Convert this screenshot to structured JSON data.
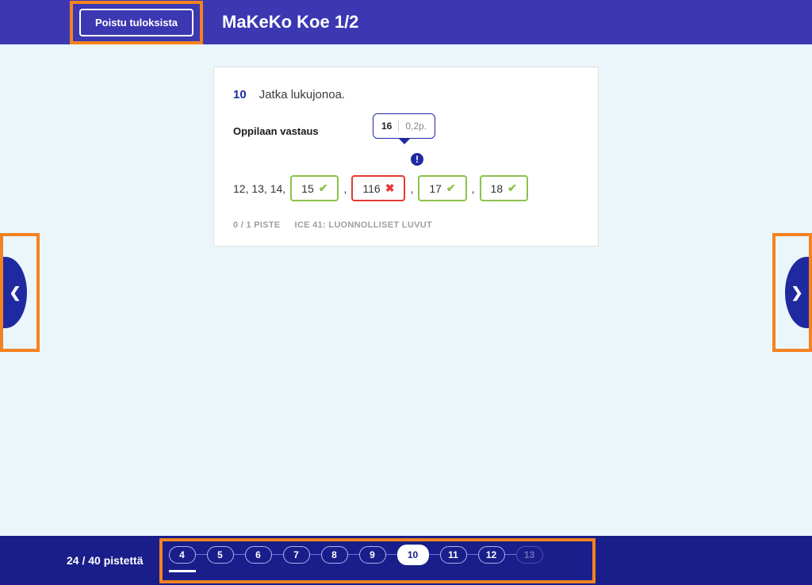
{
  "header": {
    "exit_label": "Poistu tuloksista",
    "title": "MaKeKo Koe 1/2"
  },
  "question": {
    "number": "10",
    "prompt": "Jatka lukujonoa.",
    "answer_label": "Oppilaan vastaus",
    "tooltip_value": "16",
    "tooltip_points": "0,2p.",
    "prefix": "12, 13, 14,",
    "sep": ",",
    "items": [
      {
        "value": "15",
        "correct": true
      },
      {
        "value": "116",
        "correct": false
      },
      {
        "value": "17",
        "correct": true
      },
      {
        "value": "18",
        "correct": true
      }
    ],
    "score_meta": "0 / 1 PISTE",
    "topic_meta": "ICE 41: LUONNOLLISET LUVUT"
  },
  "footer": {
    "score": "24 / 40 pistettä",
    "pages": [
      "4",
      "5",
      "6",
      "7",
      "8",
      "9",
      "10",
      "11",
      "12",
      "13"
    ],
    "active": "10",
    "dim": [
      "13"
    ]
  }
}
